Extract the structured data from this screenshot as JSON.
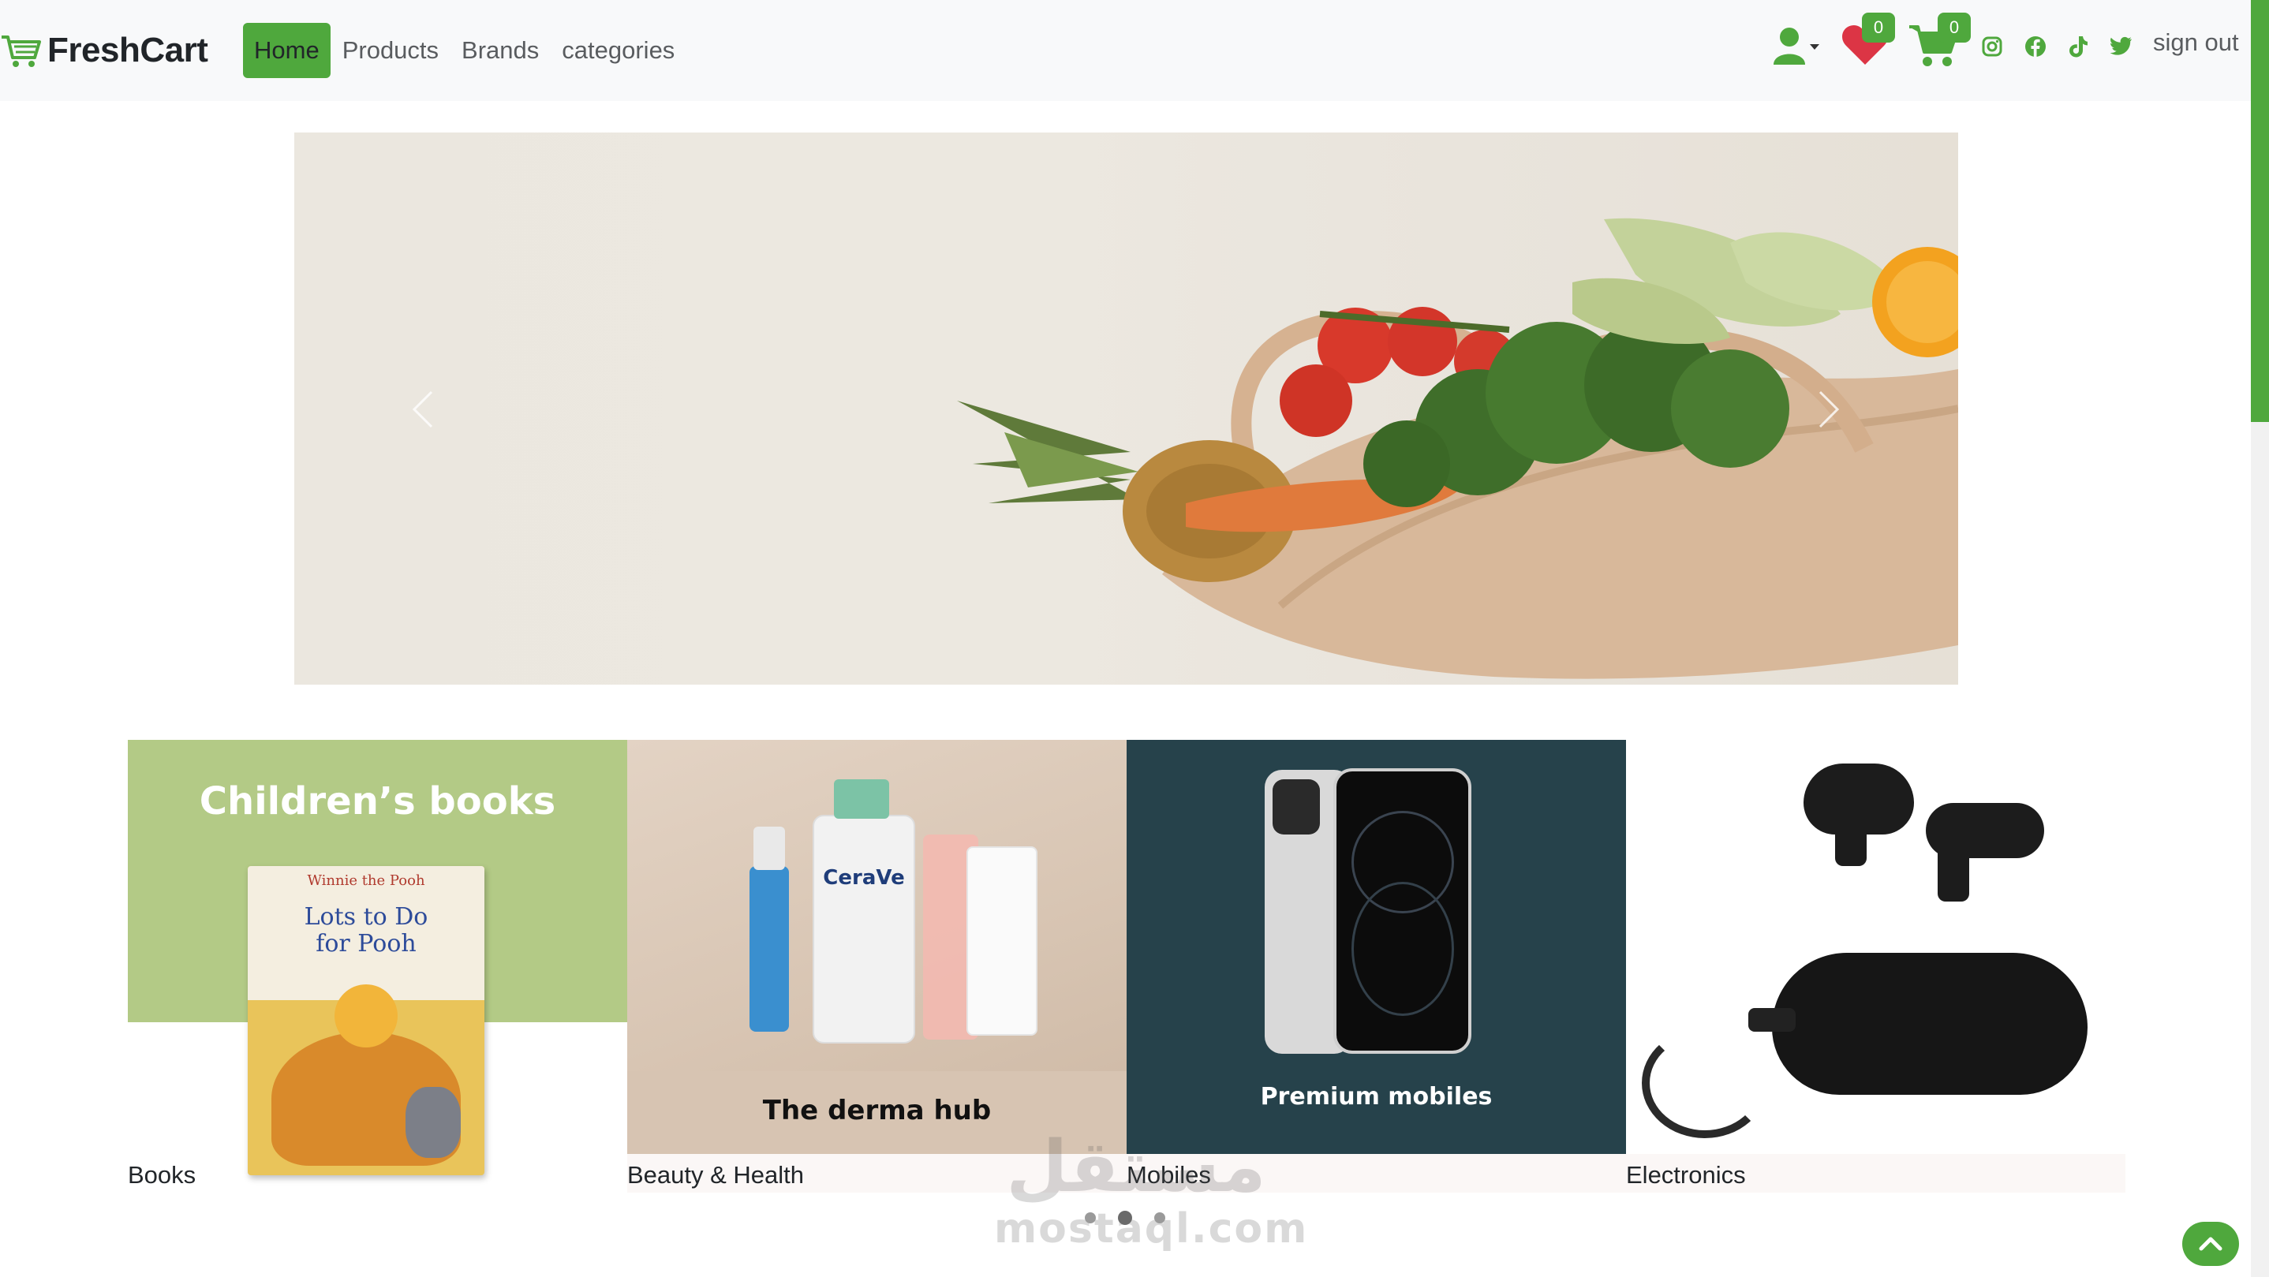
{
  "brand": {
    "name": "FreshCart",
    "icon": "cart-icon"
  },
  "nav": {
    "links": [
      {
        "label": "Home",
        "active": true
      },
      {
        "label": "Products",
        "active": false
      },
      {
        "label": "Brands",
        "active": false
      },
      {
        "label": "categories",
        "active": false
      }
    ]
  },
  "actions": {
    "user_icon": "user-icon",
    "wishlist_count": "0",
    "cart_count": "0",
    "socials": [
      "instagram-icon",
      "facebook-icon",
      "tiktok-icon",
      "twitter-icon"
    ],
    "signout_label": "sign out"
  },
  "hero": {
    "image": "grocery bag with vegetables",
    "prev_icon": "chevron-left-icon",
    "next_icon": "chevron-right-icon"
  },
  "categories": {
    "items": [
      {
        "label": "Books",
        "banner_text": "Children’s books",
        "book_title_line1": "Lots to Do",
        "book_title_line2": "for Pooh",
        "book_series": "Winnie the Pooh"
      },
      {
        "label": "Beauty & Health",
        "banner_text": "The derma hub",
        "product_brand": "CeraVe"
      },
      {
        "label": "Mobiles",
        "banner_text": "Premium mobiles"
      },
      {
        "label": "Electronics"
      }
    ],
    "dots": 3,
    "active_dot": 1
  },
  "watermark": {
    "arabic": "مستقل",
    "latin": "mostaql.com"
  },
  "colors": {
    "accent": "#4fa83d",
    "navbar_bg": "#f8f9fa"
  }
}
